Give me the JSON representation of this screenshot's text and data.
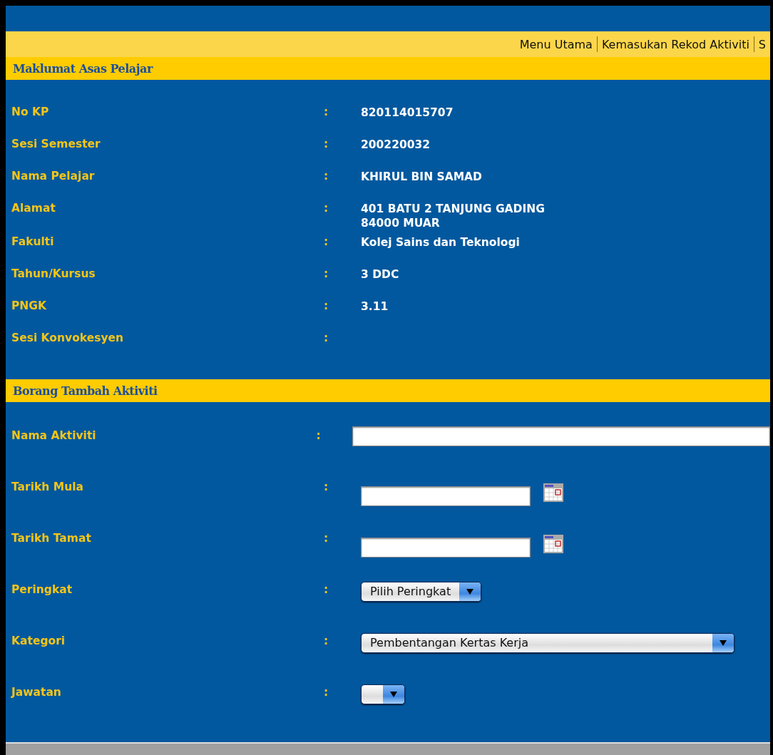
{
  "nav": [
    {
      "label": "Menu Utama"
    },
    {
      "label": "Kemasukan Rekod Aktiviti"
    },
    {
      "label": "S"
    }
  ],
  "student_section": {
    "title": "Maklumat Asas Pelajar",
    "fields": [
      {
        "label": "No KP",
        "separator": ":",
        "value": [
          "820114015707"
        ]
      },
      {
        "label": "Sesi Semester",
        "separator": ":",
        "value": [
          "200220032"
        ]
      },
      {
        "label": "Nama Pelajar",
        "separator": ":",
        "value": [
          "KHIRUL BIN SAMAD"
        ]
      },
      {
        "label": "Alamat",
        "separator": ":",
        "value": [
          "401 BATU 2 TANJUNG GADING",
          "84000 MUAR"
        ]
      },
      {
        "label": "Fakulti",
        "separator": ":",
        "value": [
          "Kolej Sains dan Teknologi"
        ]
      },
      {
        "label": "Tahun/Kursus",
        "separator": ":",
        "value": [
          "3 DDC"
        ]
      },
      {
        "label": "PNGK",
        "separator": ":",
        "value": [
          "3.11"
        ]
      },
      {
        "label": "Sesi Konvokesyen",
        "separator": ":"
      }
    ]
  },
  "form_section": {
    "title": "Borang Tambah Aktiviti",
    "fields": [
      {
        "label": "Nama Aktiviti",
        "separator": ":",
        "kind": "text"
      },
      {
        "label": "Tarikh Mula",
        "separator": ":",
        "kind": "date"
      },
      {
        "label": "Tarikh Tamat",
        "separator": ":",
        "kind": "date"
      },
      {
        "label": "Peringkat",
        "separator": ":",
        "kind": "select",
        "value": "Pilih Peringkat"
      },
      {
        "label": "Kategori",
        "separator": ":",
        "kind": "select",
        "value": "Pembentangan Kertas Kerja",
        "wide": true
      },
      {
        "label": "Jawatan",
        "separator": ":",
        "kind": "select"
      }
    ]
  }
}
